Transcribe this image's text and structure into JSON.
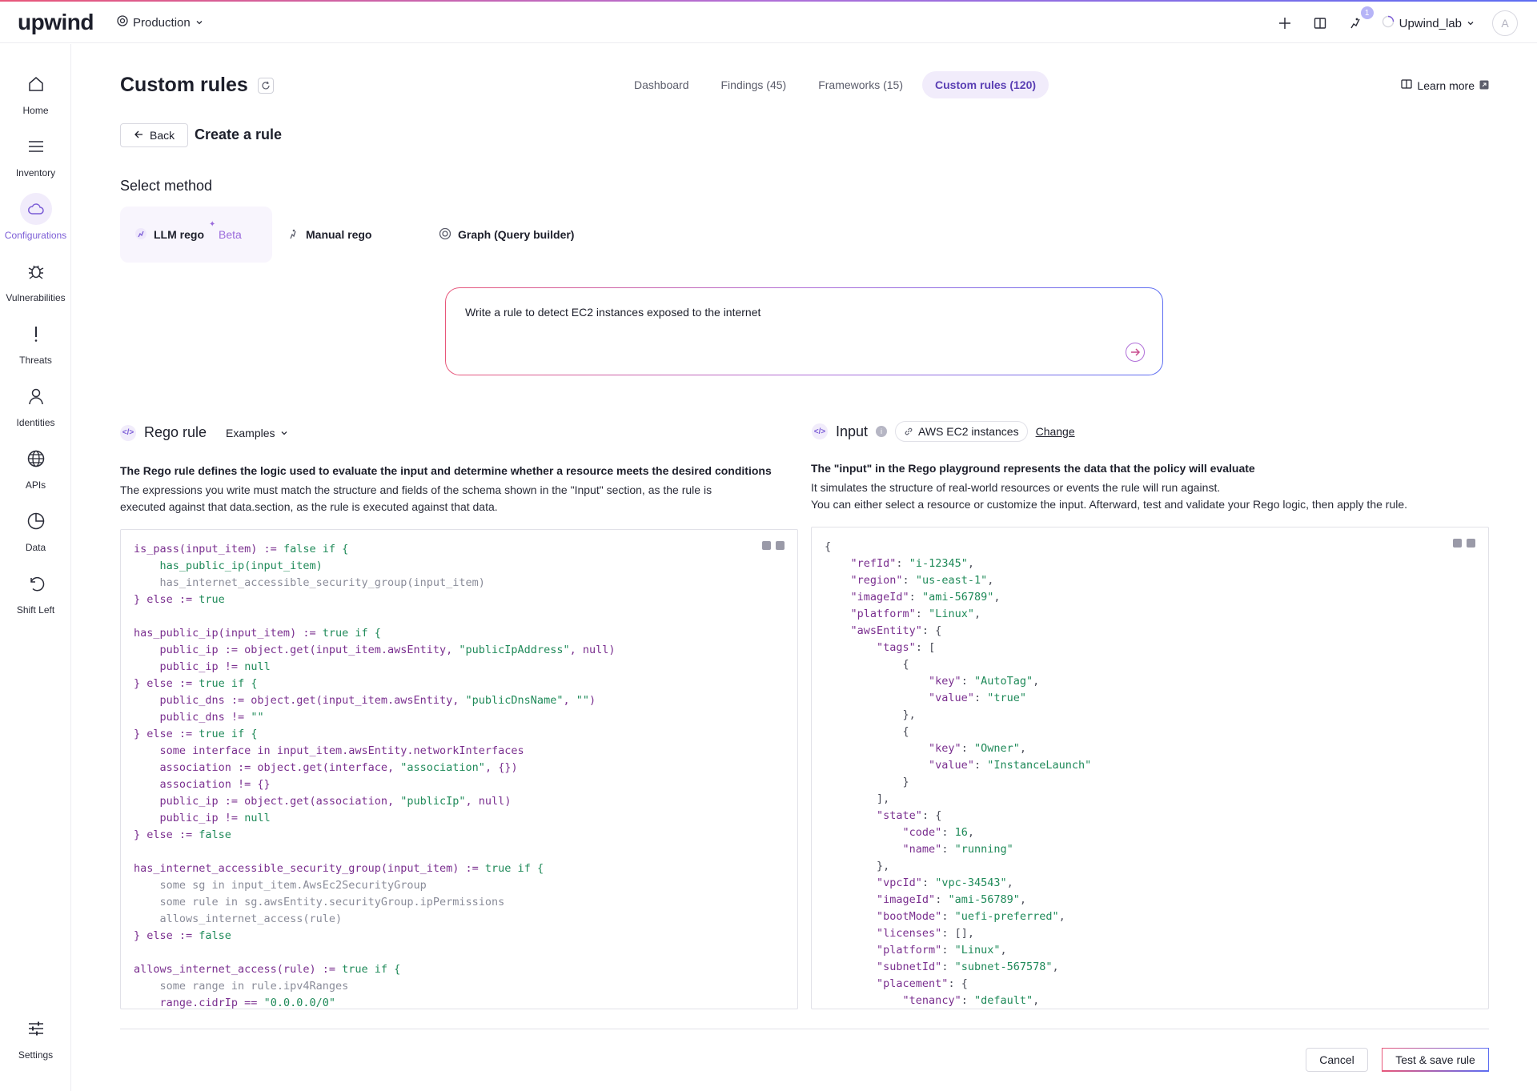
{
  "brand": "upwind",
  "topbar": {
    "environment": "Production",
    "notification_count": "1",
    "org": "Upwind_lab",
    "avatar_initial": "A"
  },
  "sidebar": {
    "items": [
      {
        "label": "Home",
        "icon": "home-icon"
      },
      {
        "label": "Inventory",
        "icon": "list-icon"
      },
      {
        "label": "Configurations",
        "icon": "cloud-icon",
        "active": true
      },
      {
        "label": "Vulnerabilities",
        "icon": "bug-icon"
      },
      {
        "label": "Threats",
        "icon": "exclamation-icon"
      },
      {
        "label": "Identities",
        "icon": "user-icon"
      },
      {
        "label": "APIs",
        "icon": "globe-icon"
      },
      {
        "label": "Data",
        "icon": "pie-icon"
      },
      {
        "label": "Shift Left",
        "icon": "undo-icon"
      }
    ],
    "settings": "Settings"
  },
  "header": {
    "title": "Custom rules",
    "tabs": [
      {
        "label": "Dashboard"
      },
      {
        "label": "Findings (45)"
      },
      {
        "label": "Frameworks (15)"
      },
      {
        "label": "Custom rules (120)",
        "active": true
      }
    ],
    "learn_more": "Learn more"
  },
  "create": {
    "back": "Back",
    "title": "Create a rule",
    "select_method": "Select method",
    "methods": [
      {
        "label": "LLM rego",
        "beta": "Beta",
        "active": true
      },
      {
        "label": "Manual rego"
      },
      {
        "label": "Graph (Query builder)"
      }
    ],
    "prompt": "Write a rule to detect EC2 instances exposed to the internet"
  },
  "rego": {
    "title": "Rego rule",
    "examples": "Examples",
    "desc_bold": "The Rego rule defines the logic used to evaluate the input and determine whether a resource meets the desired conditions",
    "desc_1": "The expressions you write must match the structure and fields of the schema shown in the \"Input\" section, as the rule is",
    "desc_2": "executed against that data.section, as the rule is executed against that data."
  },
  "input": {
    "title": "Input",
    "resource": "AWS EC2 instances",
    "change": "Change",
    "desc_bold": "The \"input\" in the Rego playground represents the data that the policy will evaluate",
    "desc_1": "It simulates the structure of real-world resources or events the rule will run against.",
    "desc_2": "You can either select a resource or customize the input. Afterward, test and validate your Rego logic, then apply the rule."
  },
  "footer": {
    "cancel": "Cancel",
    "save": "Test & save rule"
  },
  "colors": {
    "accent": "#7b5cd6",
    "code_keyword": "#7a2f8f",
    "code_string": "#1f8a59"
  }
}
